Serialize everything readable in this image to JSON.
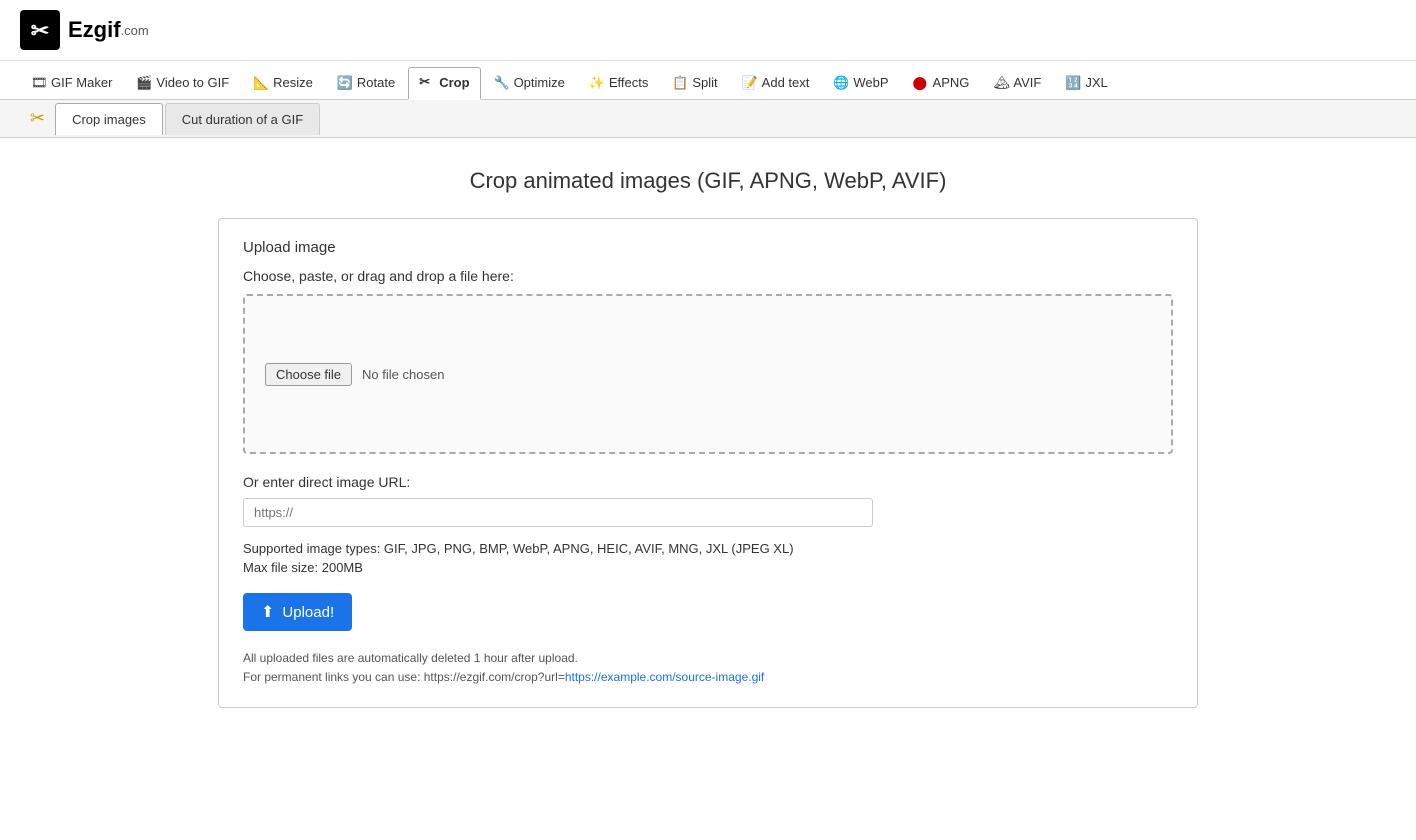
{
  "site": {
    "name": "Ezgif",
    "com": ".com"
  },
  "nav": {
    "items": [
      {
        "id": "gif-maker",
        "label": "GIF Maker",
        "icon": "🎞",
        "active": false
      },
      {
        "id": "video-to-gif",
        "label": "Video to GIF",
        "icon": "🎬",
        "active": false
      },
      {
        "id": "resize",
        "label": "Resize",
        "icon": "📐",
        "active": false
      },
      {
        "id": "rotate",
        "label": "Rotate",
        "icon": "🔄",
        "active": false
      },
      {
        "id": "crop",
        "label": "Crop",
        "icon": "✂",
        "active": true
      },
      {
        "id": "optimize",
        "label": "Optimize",
        "icon": "🔧",
        "active": false
      },
      {
        "id": "effects",
        "label": "Effects",
        "icon": "✨",
        "active": false
      },
      {
        "id": "split",
        "label": "Split",
        "icon": "📋",
        "active": false
      },
      {
        "id": "add-text",
        "label": "Add text",
        "icon": "📝",
        "active": false
      },
      {
        "id": "webp",
        "label": "WebP",
        "icon": "🌐",
        "active": false
      },
      {
        "id": "apng",
        "label": "APNG",
        "icon": "🔴",
        "active": false
      },
      {
        "id": "avif",
        "label": "AVIF",
        "icon": "🏔",
        "active": false
      },
      {
        "id": "jxl",
        "label": "JXL",
        "icon": "🔢",
        "active": false
      }
    ]
  },
  "subtabs": {
    "items": [
      {
        "id": "crop-images",
        "label": "Crop images",
        "active": true
      },
      {
        "id": "cut-duration",
        "label": "Cut duration of a GIF",
        "active": false
      }
    ]
  },
  "page": {
    "title": "Crop animated images (GIF, APNG, WebP, AVIF)"
  },
  "upload_card": {
    "heading": "Upload image",
    "instructions": "Choose, paste, or drag and drop a file here:",
    "choose_file_label": "Choose file",
    "no_file_label": "No file chosen",
    "url_label": "Or enter direct image URL:",
    "url_placeholder": "https://",
    "supported_label": "Supported image types: GIF, JPG, PNG, BMP, WebP, APNG, HEIC, AVIF, MNG, JXL (JPEG XL)",
    "max_size_label": "Max file size: 200MB",
    "upload_button_label": "Upload!",
    "footer_note1": "All uploaded files are automatically deleted 1 hour after upload.",
    "footer_note2_prefix": "For permanent links you can use: https://ezgif.com/crop?url=",
    "footer_note2_link": "https://example.com/source-image.gif"
  }
}
